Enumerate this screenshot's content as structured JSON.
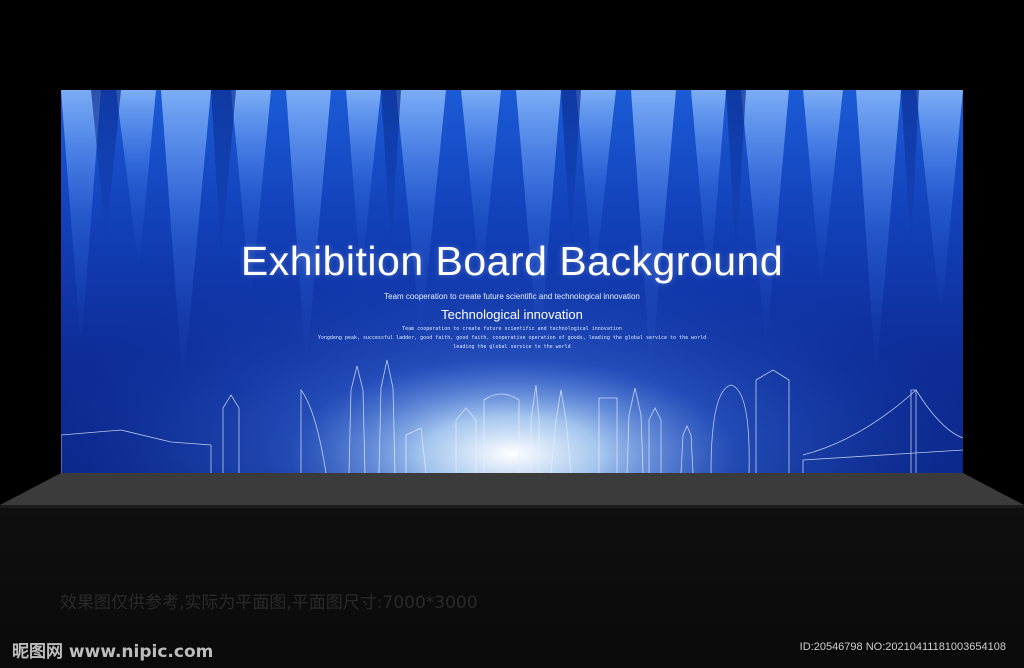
{
  "board": {
    "title": "Exhibition Board Background",
    "subtitle_small": "Team cooperation to create future scientific and technological innovation",
    "subtitle": "Technological innovation",
    "tiny_line_1": "Team cooperation to create future scientific and technological innovation",
    "tiny_line_2": "Yongdeng peak, successful ladder, good faith, good faith, cooperative operation of goods, leading the global service to the world",
    "tiny_line_3": "leading the global service to the world"
  },
  "caption": "效果图仅供参考,实际为平面图,平面图尺寸:7000*3000",
  "watermark": {
    "logo_text": "昵图网 www.nipic.com",
    "id_text": "ID:20546798 NO:20210411181003654108"
  },
  "colors": {
    "background": "#000000",
    "board_blue": "#1240b8",
    "glow": "#ffffff"
  }
}
